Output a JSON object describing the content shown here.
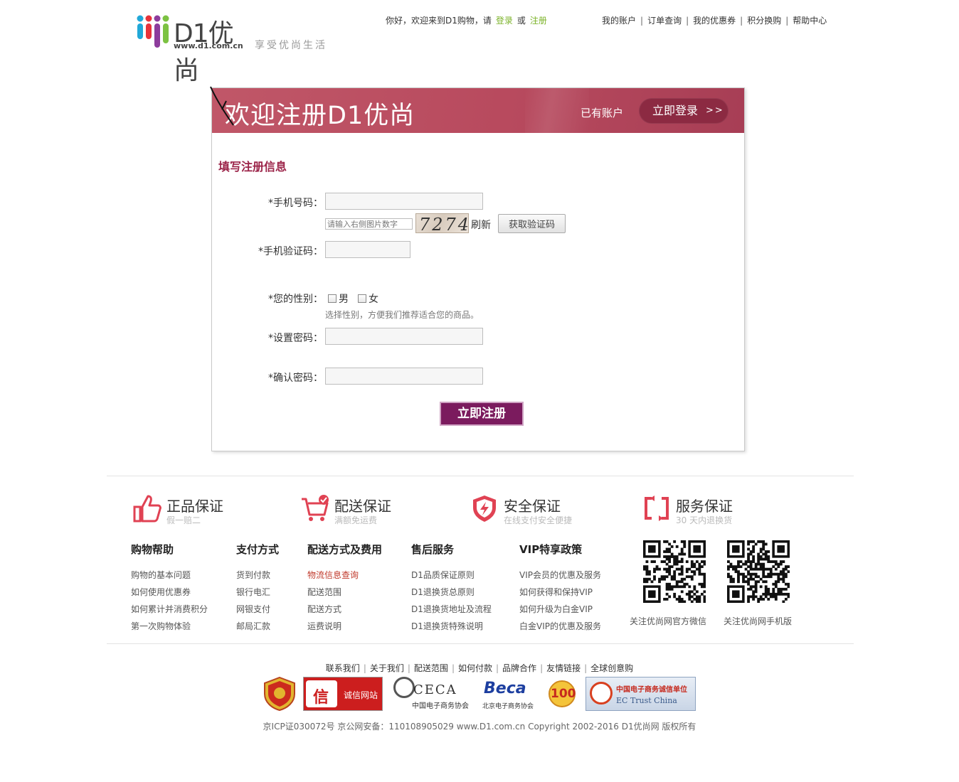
{
  "header": {
    "logo_text": "D1优尚",
    "logo_url": "www.d1.com.cn",
    "slogan": "享受优尚生活",
    "welcome": "你好，欢迎来到D1购物，请",
    "login_link": "登录",
    "or_text": "或",
    "register_link": "注册",
    "topnav": [
      "我的账户",
      "订单查询",
      "我的优惠券",
      "积分换购",
      "帮助中心"
    ]
  },
  "register": {
    "banner_title": "欢迎注册D1优尚",
    "have_account": "已有账户",
    "login_now": "立即登录",
    "login_arrow": ">>",
    "section_title": "填写注册信息",
    "phone_label": "*手机号码：",
    "phone_value": "",
    "captcha_placeholder": "请输入右侧图片数字",
    "captcha_text": "7274",
    "refresh_label": "刷新",
    "get_code_label": "获取验证码",
    "sms_label": "*手机验证码：",
    "gender_label": "*您的性别：",
    "gender_male": "男",
    "gender_female": "女",
    "gender_hint": "选择性别，方便我们推荐适合您的商品。",
    "password_label": "*设置密码：",
    "confirm_label": "*确认密码：",
    "submit_label": "立即注册"
  },
  "guarantees": [
    {
      "title": "正品保证",
      "subtitle": "假一赔二",
      "icon": "thumbs-up-icon"
    },
    {
      "title": "配送保证",
      "subtitle": "满额免运费",
      "icon": "cart-check-icon"
    },
    {
      "title": "安全保证",
      "subtitle": "在线支付安全便捷",
      "icon": "shield-bolt-icon"
    },
    {
      "title": "服务保证",
      "subtitle": "30 天内退换货",
      "icon": "return-arrows-icon"
    }
  ],
  "footer_columns": [
    {
      "title": "购物帮助",
      "items": [
        "购物的基本问题",
        "如何使用优惠券",
        "如何累计并消费积分",
        "第一次购物体验"
      ]
    },
    {
      "title": "支付方式",
      "items": [
        "货到付款",
        "银行电汇",
        "网银支付",
        "邮局汇款"
      ]
    },
    {
      "title": "配送方式及费用",
      "items": [
        "物流信息查询",
        "配送范围",
        "配送方式",
        "运费说明"
      ]
    },
    {
      "title": "售后服务",
      "items": [
        "D1品质保证原则",
        "D1退换货总原则",
        "D1退换货地址及流程",
        "D1退换货特殊说明"
      ]
    },
    {
      "title": "VIP特享政策",
      "items": [
        "VIP会员的优惠及服务",
        "如何获得和保持VIP",
        "如何升级为白金VIP",
        "白金VIP的优惠及服务"
      ]
    }
  ],
  "qr": {
    "wechat_caption": "关注优尚网官方微信",
    "mobile_caption": "关注优尚网手机版"
  },
  "bottom_links": [
    "联系我们",
    "关于我们",
    "配送范围",
    "如何付款",
    "品牌合作",
    "友情链接",
    "全球创意购"
  ],
  "badges": {
    "trust_site": "诚信网站",
    "ceca": "CECA",
    "ceca_sub": "中国电子商务协会",
    "beca": "Beca",
    "beca_sub": "北京电子商务协会",
    "top100": "100",
    "ectrust_cn": "中国电子商务诚信单位",
    "ectrust_en": "EC Trust China",
    "xin": "信"
  },
  "copyright": "京ICP证030072号  京公网安备：110108905029   www.D1.com.cn Copyright 2002-2016 D1优尚网 版权所有",
  "colors": {
    "brand": "#b84a5e",
    "brand_dark": "#8c2a42",
    "submit": "#7b1b5e",
    "green_link": "#7cb32a",
    "accent_red": "#e04253"
  }
}
